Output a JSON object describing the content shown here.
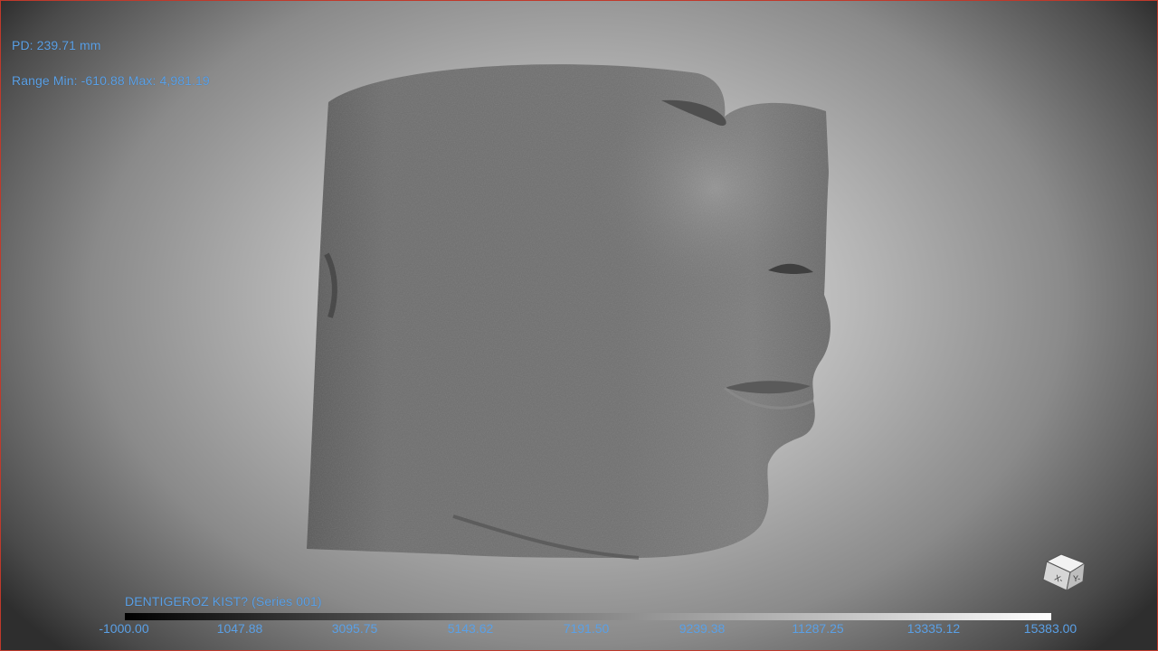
{
  "overlay": {
    "pd": "PD: 239.71 mm",
    "range": "Range Min: -610.88 Max: 4,981.19",
    "series_label": "DENTIGEROZ KIST? (Series 001)"
  },
  "colorbar": {
    "ticks": [
      "-1000.00",
      "1047.88",
      "3095.75",
      "5143.62",
      "7191.50",
      "9239.38",
      "11287.25",
      "13335.12",
      "15383.00"
    ]
  },
  "orientation_cube": {
    "face_left": "X-",
    "face_right": "Y-"
  },
  "colors": {
    "overlay_text": "#5aa0e6",
    "frame_border": "#c0392b"
  }
}
